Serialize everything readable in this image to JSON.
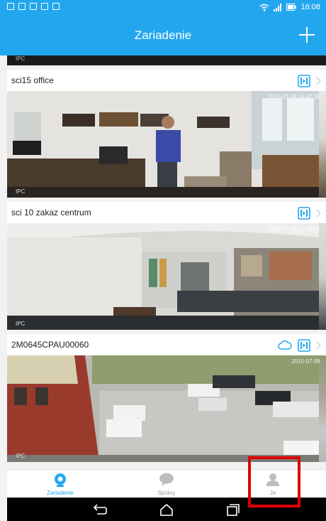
{
  "status_bar": {
    "time": "16:08"
  },
  "header": {
    "title": "Zariadenie"
  },
  "peek_card": {
    "watermark": "IPC"
  },
  "devices": [
    {
      "name": "sci15 office",
      "timestamp": "2015-07-08 14:47:35",
      "watermark": "IPC",
      "cloud": false
    },
    {
      "name": "sci 10 zakaz centrum",
      "timestamp": "2015-07-08 14:49:01",
      "watermark": "IPC",
      "cloud": false
    },
    {
      "name": "2M0645CPAU00060",
      "timestamp": "2015-07-08",
      "watermark": "IPC",
      "cloud": true
    }
  ],
  "tabs": [
    {
      "label": "Zariadenie",
      "icon": "camera-icon",
      "active": true
    },
    {
      "label": "Správy",
      "icon": "message-icon",
      "active": false
    },
    {
      "label": "Ja",
      "icon": "person-icon",
      "active": false
    }
  ],
  "colors": {
    "accent": "#22a7ee",
    "highlight": "#e00000"
  }
}
